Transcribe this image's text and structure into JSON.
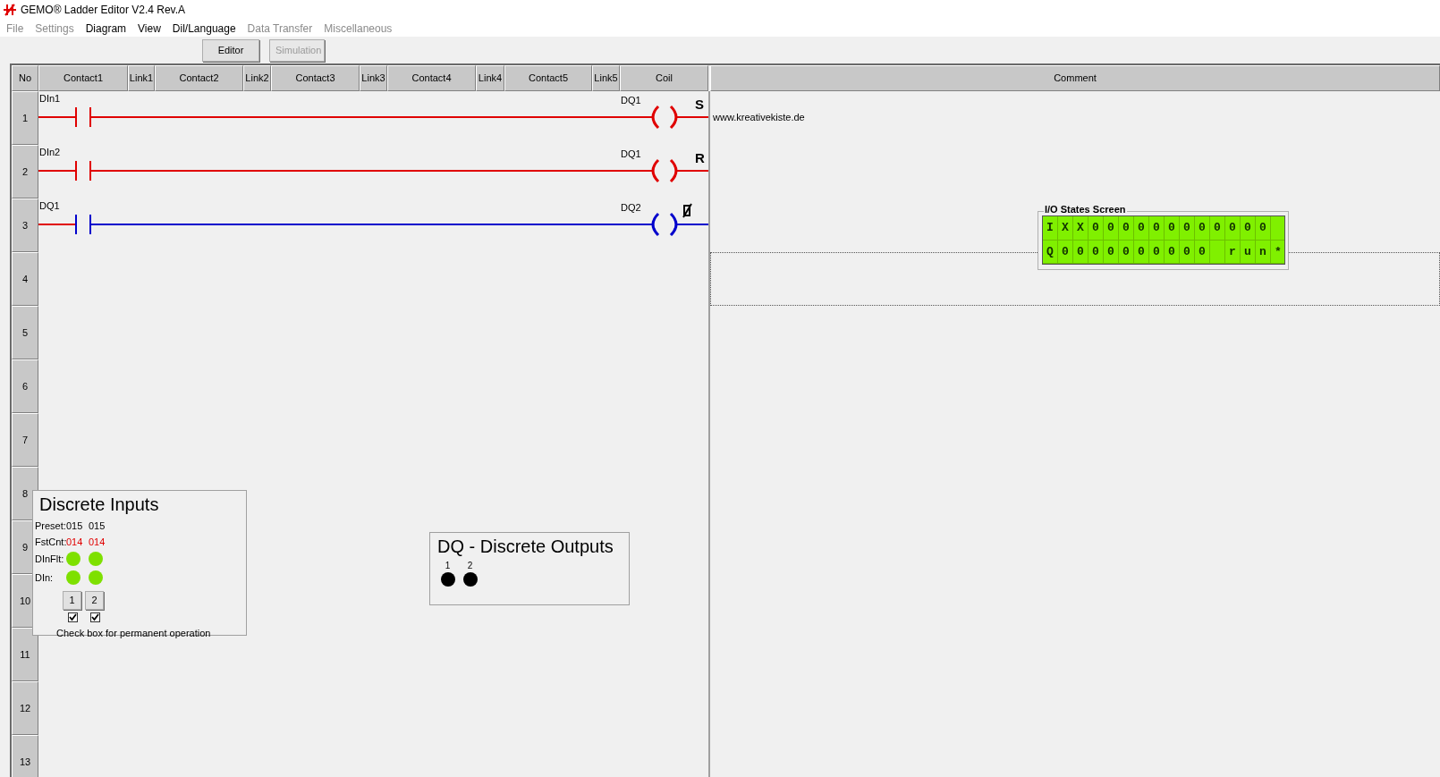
{
  "window": {
    "title": "GEMO® Ladder Editor V2.4 Rev.A"
  },
  "menu": [
    {
      "label": "File",
      "disabled": true
    },
    {
      "label": "Settings",
      "disabled": true
    },
    {
      "label": "Diagram",
      "disabled": false
    },
    {
      "label": "View",
      "disabled": false
    },
    {
      "label": "Dil/Language",
      "disabled": false
    },
    {
      "label": "Data Transfer",
      "disabled": true
    },
    {
      "label": "Miscellaneous",
      "disabled": true
    }
  ],
  "toolbar": [
    {
      "label": "Editor",
      "disabled": false
    },
    {
      "label": "Simulation",
      "disabled": true
    }
  ],
  "ladder": {
    "columns": [
      "No",
      "Contact1",
      "Link1",
      "Contact2",
      "Link2",
      "Contact3",
      "Link3",
      "Contact4",
      "Link4",
      "Contact5",
      "Link5",
      "Coil",
      "Comment"
    ],
    "rows": [
      {
        "number": "1",
        "selected": false,
        "rung": {
          "contact": {
            "label": "DIn1",
            "energized": true
          },
          "coil": {
            "label": "DQ1",
            "energized": true,
            "kind": "letter",
            "mark": "S"
          }
        },
        "comment": "www.kreativekiste.de"
      },
      {
        "number": "2",
        "selected": false,
        "rung": {
          "contact": {
            "label": "DIn2",
            "energized": true
          },
          "coil": {
            "label": "DQ1",
            "energized": true,
            "kind": "letter",
            "mark": "R"
          }
        }
      },
      {
        "number": "3",
        "selected": false,
        "rung": {
          "contact": {
            "label": "DQ1",
            "energized": false
          },
          "coil": {
            "label": "DQ2",
            "energized": false,
            "kind": "symbol"
          }
        }
      },
      {
        "number": "4",
        "selected": true
      },
      {
        "number": "5",
        "selected": false
      },
      {
        "number": "6",
        "selected": false
      },
      {
        "number": "7",
        "selected": false
      },
      {
        "number": "8",
        "selected": false
      },
      {
        "number": "9",
        "selected": false
      },
      {
        "number": "10",
        "selected": false
      },
      {
        "number": "11",
        "selected": false
      },
      {
        "number": "12",
        "selected": false
      },
      {
        "number": "13",
        "selected": false
      }
    ]
  },
  "io_screen": {
    "title": "I/O States Screen",
    "lines": [
      "IXX000000000000",
      "Q0000000000 run*"
    ]
  },
  "discrete_inputs": {
    "title": "Discrete Inputs",
    "labels": {
      "preset": "Preset:",
      "fast_count": "FstCnt:",
      "filter": "DInFlt:",
      "input": "DIn:"
    },
    "channels": [
      {
        "preset": "015",
        "fast_count": "014",
        "filter_on": true,
        "input_on": true,
        "button": "1",
        "checked": true
      },
      {
        "preset": "015",
        "fast_count": "014",
        "filter_on": true,
        "input_on": true,
        "button": "2",
        "checked": true
      }
    ],
    "note": "Check box for permanent operation"
  },
  "discrete_outputs": {
    "title": "DQ - Discrete Outputs",
    "channels": [
      {
        "label": "1",
        "on": false
      },
      {
        "label": "2",
        "on": false
      }
    ]
  }
}
